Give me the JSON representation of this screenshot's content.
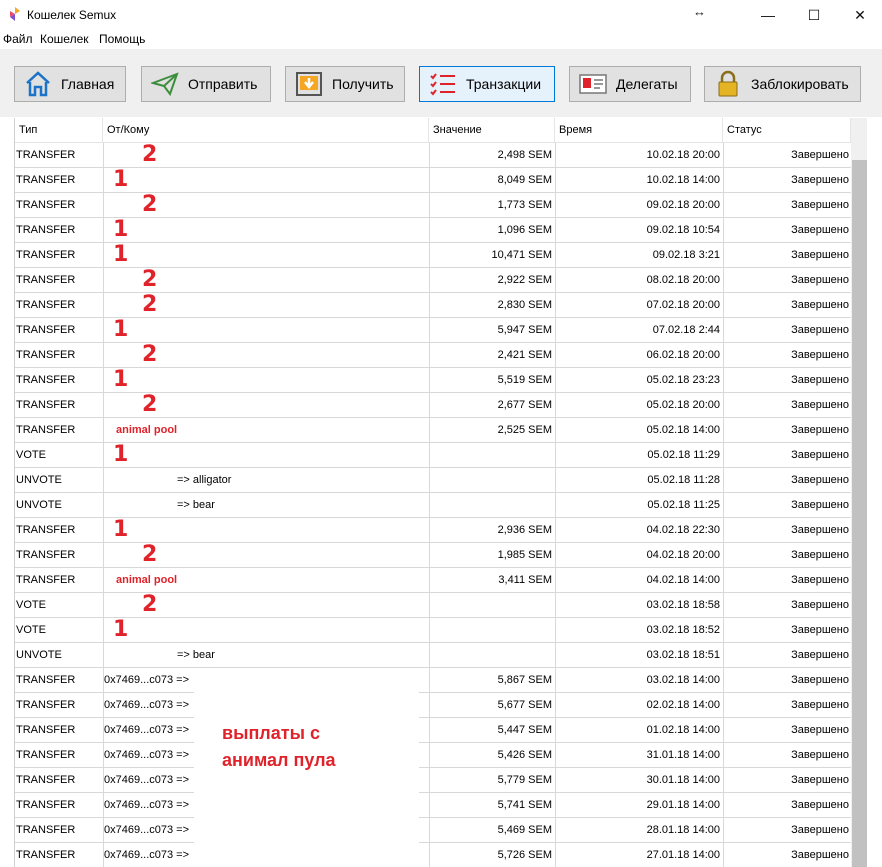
{
  "window": {
    "title": "Кошелек Semux",
    "minimize": "—",
    "maximize": "☐",
    "close": "✕",
    "resize_icon": "↔"
  },
  "menu": [
    "Файл",
    "Кошелек",
    "Помощь"
  ],
  "toolbar": [
    {
      "label": "Главная",
      "icon": "home-icon",
      "active": false
    },
    {
      "label": "Отправить",
      "icon": "paper-plane-icon",
      "active": false
    },
    {
      "label": "Получить",
      "icon": "download-tray-icon",
      "active": false
    },
    {
      "label": "Транзакции",
      "icon": "list-icon",
      "active": true
    },
    {
      "label": "Делегаты",
      "icon": "id-card-icon",
      "active": false
    },
    {
      "label": "Заблокировать",
      "icon": "lock-icon",
      "active": false
    }
  ],
  "table": {
    "columns": [
      "Тип",
      "От/Кому",
      "Значение",
      "Время",
      "Статус"
    ],
    "rows": [
      {
        "type": "TRANSFER",
        "party": "",
        "mark": "2",
        "value": "2,498 SEM",
        "time": "10.02.18 20:00",
        "status": "Завершено"
      },
      {
        "type": "TRANSFER",
        "party": "",
        "mark": "1",
        "value": "8,049 SEM",
        "time": "10.02.18 14:00",
        "status": "Завершено"
      },
      {
        "type": "TRANSFER",
        "party": "",
        "mark": "2",
        "value": "1,773 SEM",
        "time": "09.02.18 20:00",
        "status": "Завершено"
      },
      {
        "type": "TRANSFER",
        "party": "",
        "mark": "1",
        "value": "1,096 SEM",
        "time": "09.02.18 10:54",
        "status": "Завершено"
      },
      {
        "type": "TRANSFER",
        "party": "",
        "mark": "1",
        "value": "10,471 SEM",
        "time": "09.02.18 3:21",
        "status": "Завершено"
      },
      {
        "type": "TRANSFER",
        "party": "",
        "mark": "2",
        "value": "2,922 SEM",
        "time": "08.02.18 20:00",
        "status": "Завершено"
      },
      {
        "type": "TRANSFER",
        "party": "",
        "mark": "2",
        "value": "2,830 SEM",
        "time": "07.02.18 20:00",
        "status": "Завершено"
      },
      {
        "type": "TRANSFER",
        "party": "",
        "mark": "1",
        "value": "5,947 SEM",
        "time": "07.02.18 2:44",
        "status": "Завершено"
      },
      {
        "type": "TRANSFER",
        "party": "",
        "mark": "2",
        "value": "2,421 SEM",
        "time": "06.02.18 20:00",
        "status": "Завершено"
      },
      {
        "type": "TRANSFER",
        "party": "",
        "mark": "1",
        "value": "5,519 SEM",
        "time": "05.02.18 23:23",
        "status": "Завершено"
      },
      {
        "type": "TRANSFER",
        "party": "",
        "mark": "2",
        "value": "2,677 SEM",
        "time": "05.02.18 20:00",
        "status": "Завершено"
      },
      {
        "type": "TRANSFER",
        "party": "",
        "mark": "animal pool",
        "value": "2,525 SEM",
        "time": "05.02.18 14:00",
        "status": "Завершено"
      },
      {
        "type": "VOTE",
        "party": "",
        "mark": "1",
        "value": "",
        "time": "05.02.18 11:29",
        "status": "Завершено"
      },
      {
        "type": "UNVOTE",
        "party": "=> alligator",
        "mark": "",
        "value": "",
        "time": "05.02.18 11:28",
        "status": "Завершено"
      },
      {
        "type": "UNVOTE",
        "party": "=> bear",
        "mark": "",
        "value": "",
        "time": "05.02.18 11:25",
        "status": "Завершено"
      },
      {
        "type": "TRANSFER",
        "party": "",
        "mark": "1",
        "value": "2,936 SEM",
        "time": "04.02.18 22:30",
        "status": "Завершено"
      },
      {
        "type": "TRANSFER",
        "party": "",
        "mark": "2",
        "value": "1,985 SEM",
        "time": "04.02.18 20:00",
        "status": "Завершено"
      },
      {
        "type": "TRANSFER",
        "party": "",
        "mark": "animal pool",
        "value": "3,411 SEM",
        "time": "04.02.18 14:00",
        "status": "Завершено"
      },
      {
        "type": "VOTE",
        "party": "",
        "mark": "2",
        "value": "",
        "time": "03.02.18 18:58",
        "status": "Завершено"
      },
      {
        "type": "VOTE",
        "party": "",
        "mark": "1",
        "value": "",
        "time": "03.02.18 18:52",
        "status": "Завершено"
      },
      {
        "type": "UNVOTE",
        "party": "=> bear",
        "mark": "",
        "value": "",
        "time": "03.02.18 18:51",
        "status": "Завершено"
      },
      {
        "type": "TRANSFER",
        "party": "0x7469...c073 =>",
        "mark": "",
        "value": "5,867 SEM",
        "time": "03.02.18 14:00",
        "status": "Завершено"
      },
      {
        "type": "TRANSFER",
        "party": "0x7469...c073 =>",
        "mark": "",
        "value": "5,677 SEM",
        "time": "02.02.18 14:00",
        "status": "Завершено"
      },
      {
        "type": "TRANSFER",
        "party": "0x7469...c073 =>",
        "mark": "",
        "value": "5,447 SEM",
        "time": "01.02.18 14:00",
        "status": "Завершено"
      },
      {
        "type": "TRANSFER",
        "party": "0x7469...c073 =>",
        "mark": "",
        "value": "5,426 SEM",
        "time": "31.01.18 14:00",
        "status": "Завершено"
      },
      {
        "type": "TRANSFER",
        "party": "0x7469...c073 =>",
        "mark": "",
        "value": "5,779 SEM",
        "time": "30.01.18 14:00",
        "status": "Завершено"
      },
      {
        "type": "TRANSFER",
        "party": "0x7469...c073 =>",
        "mark": "",
        "value": "5,741 SEM",
        "time": "29.01.18 14:00",
        "status": "Завершено"
      },
      {
        "type": "TRANSFER",
        "party": "0x7469...c073 =>",
        "mark": "",
        "value": "5,469 SEM",
        "time": "28.01.18 14:00",
        "status": "Завершено"
      },
      {
        "type": "TRANSFER",
        "party": "0x7469...c073 =>",
        "mark": "",
        "value": "5,726 SEM",
        "time": "27.01.18 14:00",
        "status": "Завершено"
      }
    ]
  },
  "annotation": "выплаты с\nанимал пула",
  "colors": {
    "accent": "#0078d7",
    "annotation_red": "#e0222a"
  }
}
